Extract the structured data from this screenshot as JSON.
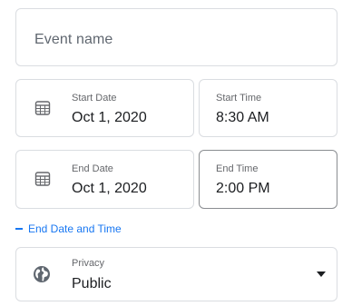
{
  "event_name": {
    "placeholder": "Event name",
    "value": ""
  },
  "start": {
    "date_label": "Start Date",
    "date_value": "Oct 1, 2020",
    "time_label": "Start Time",
    "time_value": "8:30 AM"
  },
  "end": {
    "date_label": "End Date",
    "date_value": "Oct 1, 2020",
    "time_label": "End Time",
    "time_value": "2:00 PM"
  },
  "toggle": {
    "label": "End Date and Time"
  },
  "privacy": {
    "label": "Privacy",
    "value": "Public"
  },
  "icons": {
    "calendar": "calendar-icon",
    "globe": "globe-icon",
    "caret": "caret-down-icon",
    "minus": "minus-icon"
  },
  "colors": {
    "accent": "#1877f2",
    "border": "#dadde1",
    "border_active": "#8a8d91",
    "text_primary": "#1c1e21",
    "text_secondary": "#65676b"
  }
}
